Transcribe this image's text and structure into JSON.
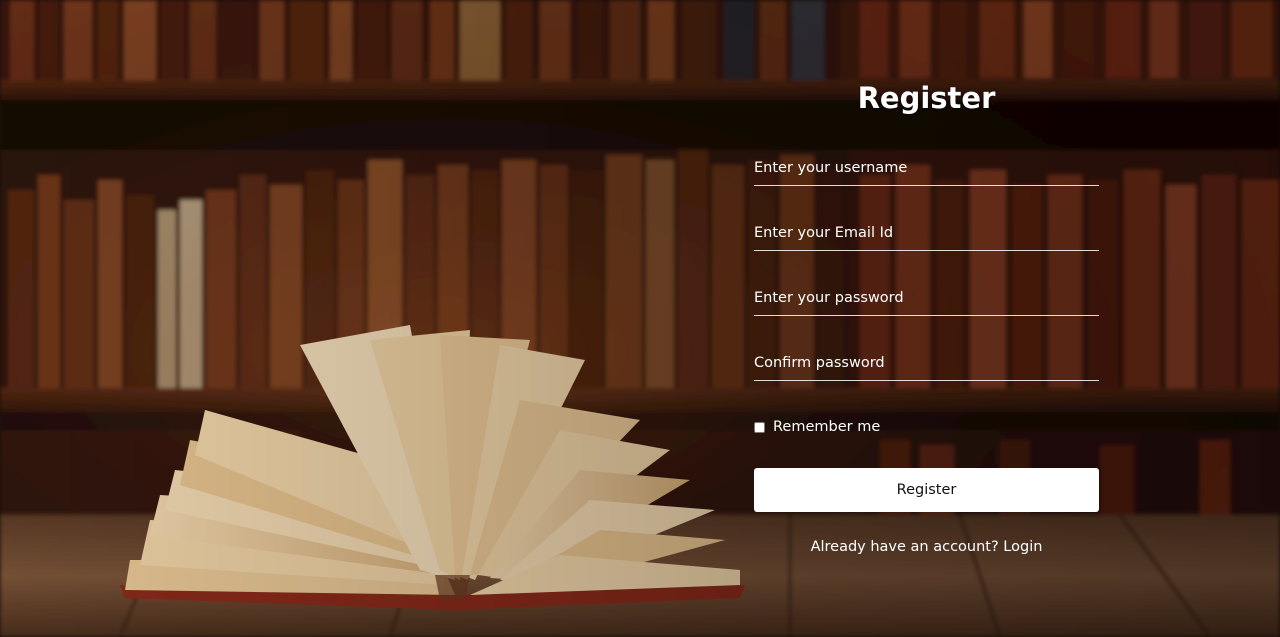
{
  "form": {
    "title": "Register",
    "username_placeholder": "Enter your username",
    "email_placeholder": "Enter your Email Id",
    "password_placeholder": "Enter your password",
    "confirm_placeholder": "Confirm password",
    "remember_label": "Remember me",
    "remember_checked": false,
    "submit_label": "Register",
    "login_prompt": "Already have an account?",
    "login_link": "Login"
  },
  "colors": {
    "text": "#ffffff",
    "button_bg": "#ffffff",
    "button_text": "#111111",
    "bookshelf_wood": "#3a1a0c"
  }
}
